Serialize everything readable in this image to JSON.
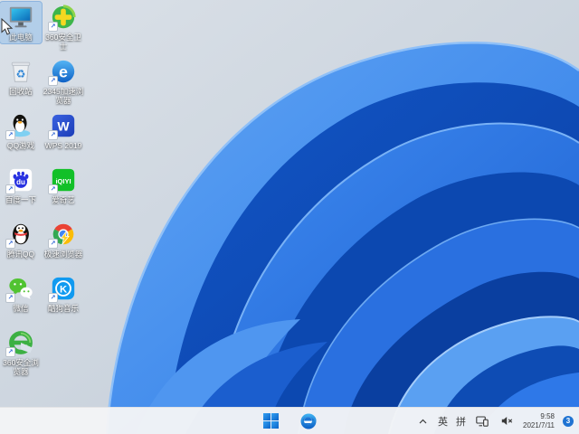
{
  "desktop": {
    "icons": [
      {
        "label": "此电脑",
        "selected": true
      },
      {
        "label": "360安全卫士"
      },
      {
        "label": "回收站"
      },
      {
        "label": "2345加速浏览器"
      },
      {
        "label": "QQ游戏"
      },
      {
        "label": "WPS 2019"
      },
      {
        "label": "百度一下"
      },
      {
        "label": "爱奇艺"
      },
      {
        "label": "腾讯QQ"
      },
      {
        "label": "极速浏览器"
      },
      {
        "label": "微信"
      },
      {
        "label": "酷狗音乐"
      },
      {
        "label": "360安全浏览器"
      }
    ],
    "shortcut_arrow": "↗"
  },
  "taskbar": {
    "tray": {
      "ime_english": "英",
      "ime_pinyin": "拼",
      "time": "9:58",
      "date": "2021/7/11",
      "notification_count": "3"
    }
  },
  "colors": {
    "wallpaper_blue_deep": "#0c48b0",
    "wallpaper_blue_mid": "#2e78e8",
    "wallpaper_blue_light": "#5aa0f2",
    "sky": "#ccd6e0",
    "taskbar_bg": "#f3f4f6",
    "accent": "#1f73d2"
  }
}
